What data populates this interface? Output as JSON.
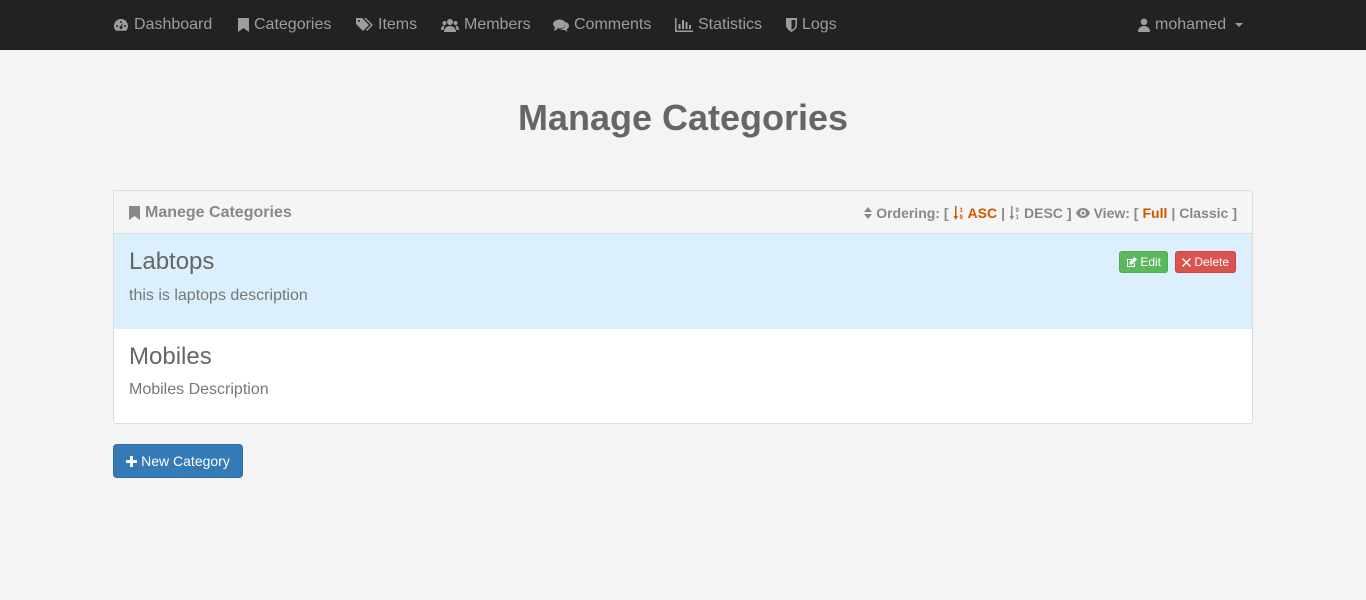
{
  "nav": {
    "items": [
      {
        "label": "Dashboard",
        "icon": "dashboard-icon"
      },
      {
        "label": "Categories",
        "icon": "bookmark-icon"
      },
      {
        "label": "Items",
        "icon": "tags-icon"
      },
      {
        "label": "Members",
        "icon": "users-icon"
      },
      {
        "label": "Comments",
        "icon": "comments-icon"
      },
      {
        "label": "Statistics",
        "icon": "bar-chart-icon"
      },
      {
        "label": "Logs",
        "icon": "shield-icon"
      }
    ],
    "user": "mohamed"
  },
  "page": {
    "title": "Manage Categories"
  },
  "panel": {
    "heading": "Manege Categories",
    "ordering_label": "Ordering: [",
    "asc": "ASC",
    "sep": "|",
    "desc": "DESC",
    "close": "]",
    "view_label": "View: [",
    "full": "Full",
    "classic": "Classic",
    "view_close": "]"
  },
  "categories": [
    {
      "name": "Labtops",
      "description": "this is laptops description"
    },
    {
      "name": "Mobiles",
      "description": "Mobiles Description"
    }
  ],
  "actions": {
    "edit": "Edit",
    "delete": "Delete",
    "new_category": "New Category"
  },
  "colors": {
    "navbar": "#222222",
    "accent_orange": "#d35400",
    "primary": "#337ab7",
    "success": "#5cb85c",
    "danger": "#d9534f",
    "hover_row": "#dbf0fc"
  }
}
